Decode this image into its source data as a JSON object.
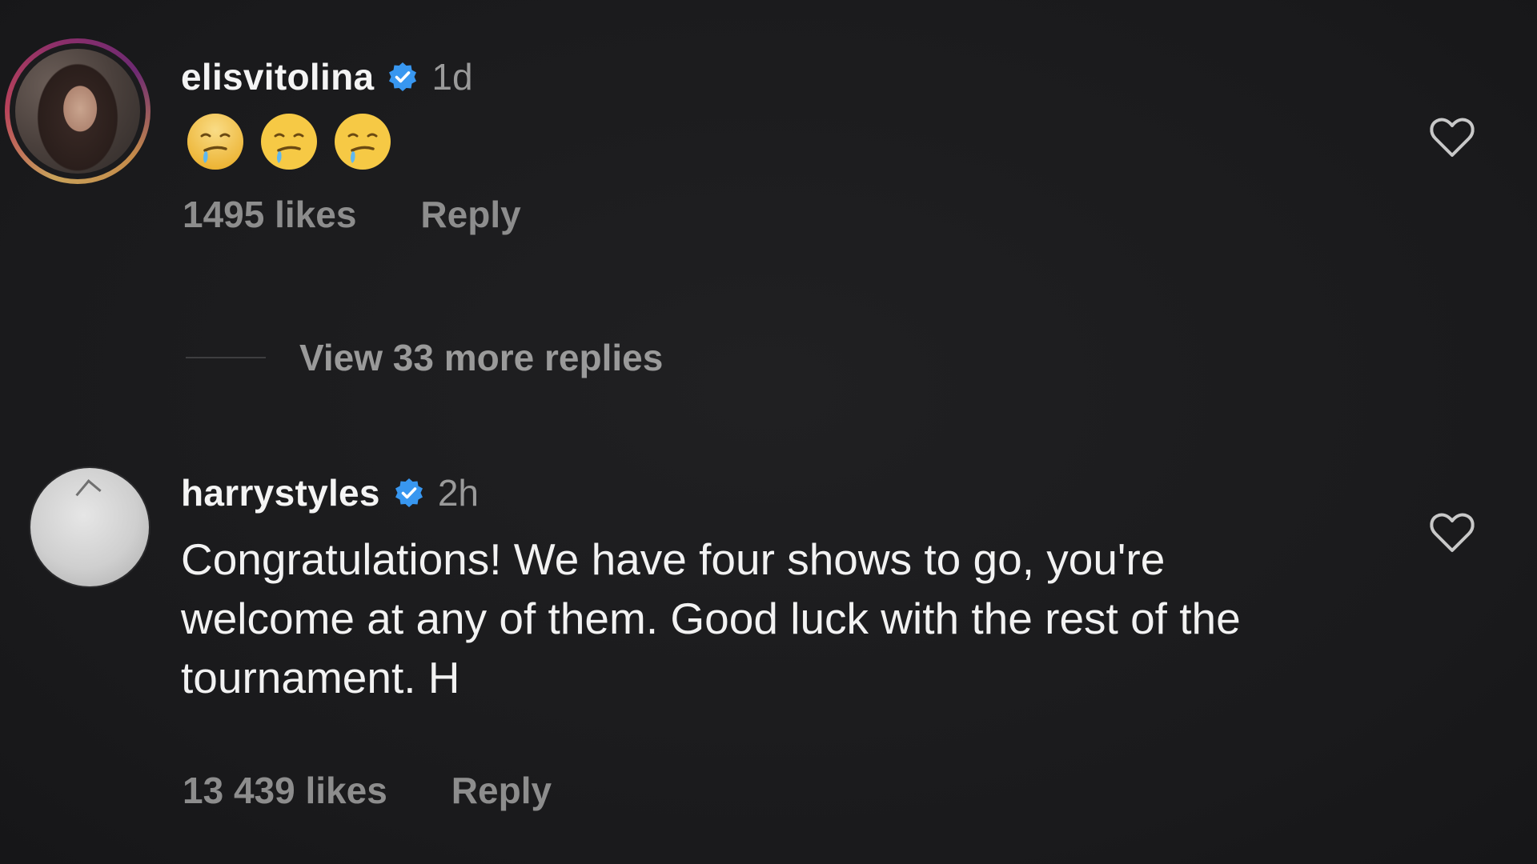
{
  "comments": [
    {
      "username": "elisvitolina",
      "verified": true,
      "time": "1d",
      "content_emojis": [
        "drooling-face",
        "drooling-face",
        "drooling-face"
      ],
      "likes": "1495 likes",
      "reply_label": "Reply",
      "avatar": "profile-photo-with-story-ring",
      "view_replies": "View 33 more replies",
      "like_icon": "heart-outline-icon"
    },
    {
      "username": "harrystyles",
      "verified": true,
      "time": "2h",
      "text": "Congratulations! We have four shows to go, you're welcome at any of them. Good luck with the rest of the tournament. H",
      "likes": "13 439 likes",
      "reply_label": "Reply",
      "avatar": "default-profile-photo",
      "like_icon": "heart-outline-icon"
    }
  ],
  "colors": {
    "background": "#1b1b1d",
    "primary_text": "#f2f2f2",
    "secondary_text": "#8d8d8d",
    "verified_badge": "#3897f0"
  }
}
